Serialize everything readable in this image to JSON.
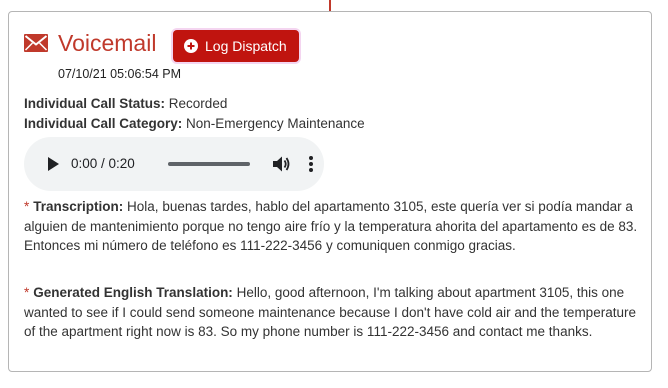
{
  "card": {
    "title": "Voicemail",
    "log_button_label": "Log Dispatch",
    "timestamp": "07/10/21 05:06:54 PM",
    "status_label": "Individual Call Status:",
    "status_value": "Recorded",
    "category_label": "Individual Call Category:",
    "category_value": "Non-Emergency Maintenance"
  },
  "audio": {
    "time": "0:00 / 0:20",
    "icons": [
      "play-icon",
      "volume-icon",
      "more-options-icon"
    ]
  },
  "transcription": {
    "required_mark": "*",
    "label": "Transcription:",
    "text": "Hola, buenas tardes, hablo del apartamento 3105, este quería ver si podía mandar a alguien de mantenimiento porque no tengo aire frío y la temperatura ahorita del apartamento es de 83. Entonces mi número de teléfono es 111-222-3456 y comuniquen conmigo gracias."
  },
  "translation": {
    "required_mark": "*",
    "label": "Generated English Translation:",
    "text": "Hello, good afternoon, I'm talking about apartment 3105, this one wanted to see if I could send someone maintenance because I don't have cold air and the temperature of the apartment right now is 83. So my phone number is 111-222-3456 and contact me thanks."
  },
  "colors": {
    "accent": "#c0392b",
    "button": "#c0140f",
    "audio_bg": "#f1f3f4",
    "border": "#b5b5b5"
  }
}
